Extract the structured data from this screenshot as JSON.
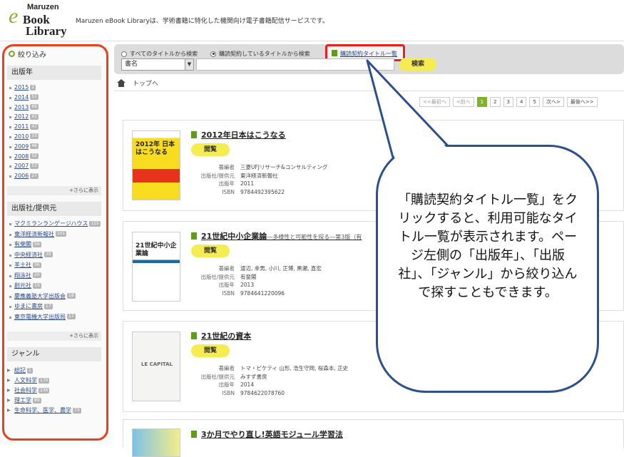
{
  "header": {
    "logo_top": "Maruzen",
    "logo_e": "e",
    "logo_book": "Book",
    "logo_library": "Library",
    "tagline": "Maruzen eBook Libraryは、学術書籍に特化した機関向け電子書籍配信サービスです。"
  },
  "sidebar": {
    "narrow_label": "絞り込み",
    "year_heading": "出版年",
    "years": [
      {
        "label": "2015",
        "count": "2"
      },
      {
        "label": "2014",
        "count": "57"
      },
      {
        "label": "2013",
        "count": "66"
      },
      {
        "label": "2012",
        "count": "41"
      },
      {
        "label": "2011",
        "count": "47"
      },
      {
        "label": "2010",
        "count": "53"
      },
      {
        "label": "2009",
        "count": "46"
      },
      {
        "label": "2008",
        "count": "52"
      },
      {
        "label": "2007",
        "count": "53"
      },
      {
        "label": "2006",
        "count": "27"
      }
    ],
    "more_label": "+さらに表示",
    "publisher_heading": "出版社/提供元",
    "publishers": [
      {
        "label": "マクミランランゲージハウス",
        "count": "115"
      },
      {
        "label": "東洋経済新報社",
        "count": "101"
      },
      {
        "label": "有斐閣",
        "count": "56"
      },
      {
        "label": "中央経済社",
        "count": "39"
      },
      {
        "label": "羊土社",
        "count": "36"
      },
      {
        "label": "翔泳社",
        "count": "20"
      },
      {
        "label": "創元社",
        "count": "19"
      },
      {
        "label": "慶應義塾大学出版会",
        "count": "18"
      },
      {
        "label": "ゆまに書房",
        "count": "17"
      },
      {
        "label": "東京電機大学出版局",
        "count": "17"
      }
    ],
    "genre_heading": "ジャンル",
    "genres": [
      {
        "label": "総記",
        "count": "1"
      },
      {
        "label": "人文科学",
        "count": "170"
      },
      {
        "label": "社会科学",
        "count": "236"
      },
      {
        "label": "理工学",
        "count": "89"
      },
      {
        "label": "生命科学、医学、農学",
        "count": "73"
      }
    ]
  },
  "search": {
    "radio_all": "すべてのタイトルから検索",
    "radio_subscribed": "購読契約しているタイトルから検索",
    "subscribed_list_link": "購読契約タイトル一覧",
    "select_value": "書名",
    "search_button": "検索"
  },
  "breadcrumb": {
    "home": "トップへ"
  },
  "pager": {
    "first": "<<最初へ",
    "prev": "<前へ",
    "pages": [
      "1",
      "2",
      "3",
      "4",
      "5"
    ],
    "next": "次へ>",
    "last": "最後へ>>"
  },
  "labels": {
    "open": "閲覧",
    "author": "著編者",
    "publisher": "出版社/提供元",
    "year": "出版年",
    "isbn": "ISBN"
  },
  "books": [
    {
      "title": "2012年日本はこうなる",
      "subtitle": "",
      "cover_text": "2012年 日本はこうなる",
      "author": "三菱UFJリサーチ&コンサルティング",
      "publisher": "東洋経済新報社",
      "year": "2011",
      "isbn": "9784492395622"
    },
    {
      "title": "21世紀中小企業論",
      "subtitle": "―多様性と可能性を探る―第3版（有",
      "cover_text": "21世紀中小企業論",
      "author": "渡辺, 幸男, 小川, 正博, 黒瀬, 直宏",
      "publisher": "有斐閣",
      "year": "2013",
      "isbn": "9784641220096"
    },
    {
      "title": "21世紀の資本",
      "subtitle": "",
      "cover_text": "LE CAPITAL",
      "author": "トマ・ピケティ 山形, 浩生守岡, 桜森本, 正史",
      "publisher": "みすず書房",
      "year": "2014",
      "isbn": "9784622078760"
    },
    {
      "title": "3か月でやり直し!英語モジュール学習法",
      "subtitle": "",
      "cover_text": ""
    }
  ],
  "callout": {
    "text": "「購読契約タイトル一覧」をクリックすると、利用可能なタイトル一覧が表示されます。ページ左側の「出版年」、「出版社」、「ジャンル」から絞り込んで探すこともできます。"
  }
}
